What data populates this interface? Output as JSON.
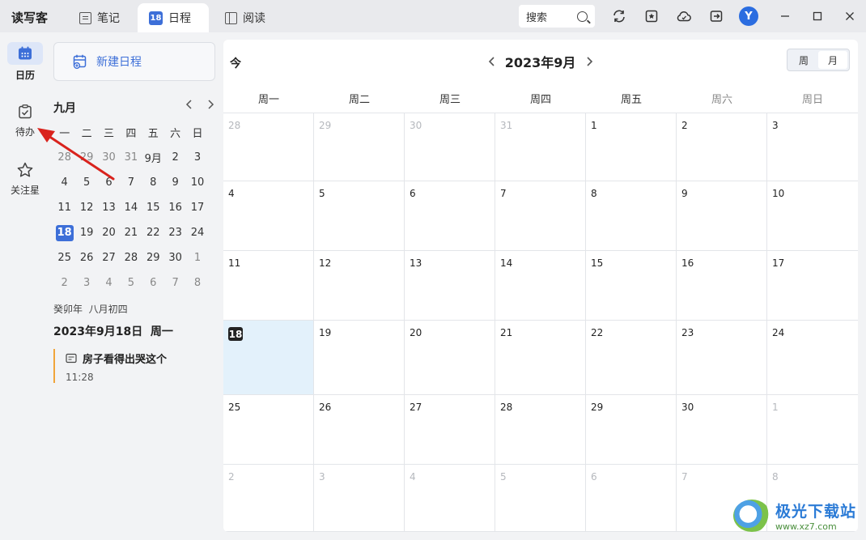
{
  "titlebar": {
    "app_name": "读写客",
    "tabs": [
      {
        "label": "笔记",
        "icon": "notes-icon"
      },
      {
        "label": "日程",
        "icon": "calendar-badge-icon",
        "badge": "18"
      },
      {
        "label": "阅读",
        "icon": "reader-icon"
      }
    ],
    "search_label": "搜索",
    "avatar_letter": "Y",
    "icons": [
      "sync-icon",
      "star-note-icon",
      "cloud-icon",
      "export-icon",
      "minimize-icon",
      "maximize-icon",
      "close-icon"
    ]
  },
  "rail": {
    "items": [
      {
        "label": "日历",
        "icon": "calendar-icon",
        "active": true
      },
      {
        "label": "待办",
        "icon": "todo-icon"
      },
      {
        "label": "关注星",
        "icon": "star-icon"
      }
    ]
  },
  "sidebar": {
    "new_button": "新建日程",
    "mini_month": "九月",
    "weekday_headers": [
      "一",
      "二",
      "三",
      "四",
      "五",
      "六",
      "日"
    ],
    "weeks": [
      [
        "28",
        "29",
        "30",
        "31",
        "9月",
        "2",
        "3"
      ],
      [
        "4",
        "5",
        "6",
        "7",
        "8",
        "9",
        "10"
      ],
      [
        "11",
        "12",
        "13",
        "14",
        "15",
        "16",
        "17"
      ],
      [
        "18",
        "19",
        "20",
        "21",
        "22",
        "23",
        "24"
      ],
      [
        "25",
        "26",
        "27",
        "28",
        "29",
        "30",
        "1"
      ],
      [
        "2",
        "3",
        "4",
        "5",
        "6",
        "7",
        "8"
      ]
    ],
    "lunar": "癸卯年  八月初四",
    "selected_date": "2023年9月18日  周一",
    "event": {
      "title": "房子看得出哭这个",
      "time": "11:28"
    }
  },
  "calendar": {
    "today_label": "今",
    "month_title": "2023年9月",
    "view_week": "周",
    "view_month": "月",
    "weekdays": [
      "周一",
      "周二",
      "周三",
      "周四",
      "周五",
      "周六",
      "周日"
    ],
    "days": [
      "28",
      "29",
      "30",
      "31",
      "1",
      "2",
      "3",
      "4",
      "5",
      "6",
      "7",
      "8",
      "9",
      "10",
      "11",
      "12",
      "13",
      "14",
      "15",
      "16",
      "17",
      "18",
      "19",
      "20",
      "21",
      "22",
      "23",
      "24",
      "25",
      "26",
      "27",
      "28",
      "29",
      "30",
      "1",
      "2",
      "3",
      "4",
      "5",
      "6",
      "7",
      "8"
    ]
  },
  "watermark": {
    "title": "极光下载站",
    "url": "www.xz7.com"
  },
  "colors": {
    "accent": "#3d6fd8",
    "today_bg": "#e3f1fb",
    "event_bar": "#f0a43a",
    "arrow": "#d9231d"
  }
}
